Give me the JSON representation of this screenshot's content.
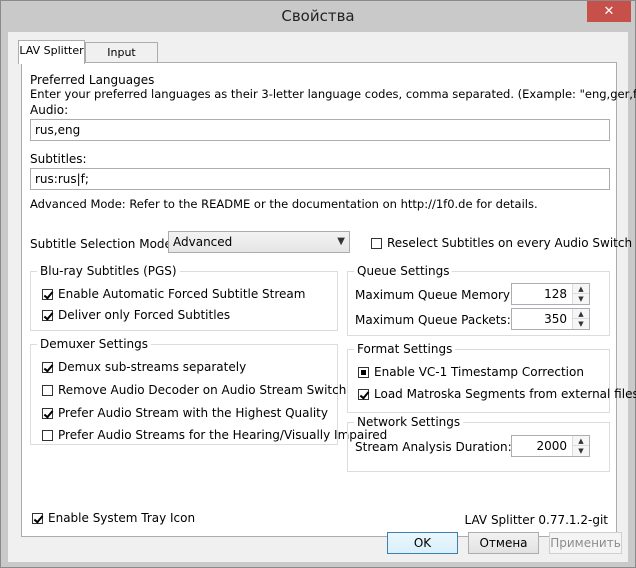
{
  "window": {
    "title": "Свойства",
    "close_glyph": "✕"
  },
  "tabs": [
    {
      "label": "LAV Splitter",
      "active": true
    },
    {
      "label": "Input Formats",
      "active": false
    }
  ],
  "preferred": {
    "heading": "Preferred Languages",
    "description": "Enter your preferred languages as their 3-letter language codes, comma separated. (Example: \"eng,ger,fre\")",
    "audio_label": "Audio:",
    "audio_value": "rus,eng",
    "subtitles_label": "Subtitles:",
    "subtitles_value": "rus:rus|f;",
    "advanced_note": "Advanced Mode: Refer to the README or the documentation on http://1f0.de for details."
  },
  "subtitle_mode": {
    "label": "Subtitle Selection Mode:",
    "selected": "Advanced",
    "reselect_label": "Reselect Subtitles on every Audio Switch",
    "reselect_checked": false
  },
  "bluray": {
    "title": "Blu-ray Subtitles (PGS)",
    "items": [
      {
        "label": "Enable Automatic Forced Subtitle Stream",
        "checked": true
      },
      {
        "label": "Deliver only Forced Subtitles",
        "checked": true
      }
    ]
  },
  "demuxer": {
    "title": "Demuxer Settings",
    "items": [
      {
        "label": "Demux sub-streams separately",
        "checked": true
      },
      {
        "label": "Remove Audio Decoder on Audio Stream Switch",
        "checked": false
      },
      {
        "label": "Prefer Audio Stream with the Highest Quality",
        "checked": true
      },
      {
        "label": "Prefer Audio Streams for the Hearing/Visually Impaired",
        "checked": false
      }
    ]
  },
  "queue": {
    "title": "Queue Settings",
    "memory_label": "Maximum Queue Memory (MB):",
    "memory_value": "128",
    "packets_label": "Maximum Queue Packets:",
    "packets_value": "350"
  },
  "format": {
    "title": "Format Settings",
    "items": [
      {
        "label": "Enable VC-1 Timestamp Correction",
        "state": "indeterminate"
      },
      {
        "label": "Load Matroska Segments from external files",
        "checked": true
      }
    ]
  },
  "network": {
    "title": "Network Settings",
    "duration_label": "Stream Analysis Duration:",
    "duration_value": "2000"
  },
  "tray": {
    "label": "Enable System Tray Icon",
    "checked": true
  },
  "version": "LAV Splitter 0.77.1.2-git",
  "buttons": {
    "ok": "OK",
    "cancel": "Отмена",
    "apply": "Применить"
  }
}
